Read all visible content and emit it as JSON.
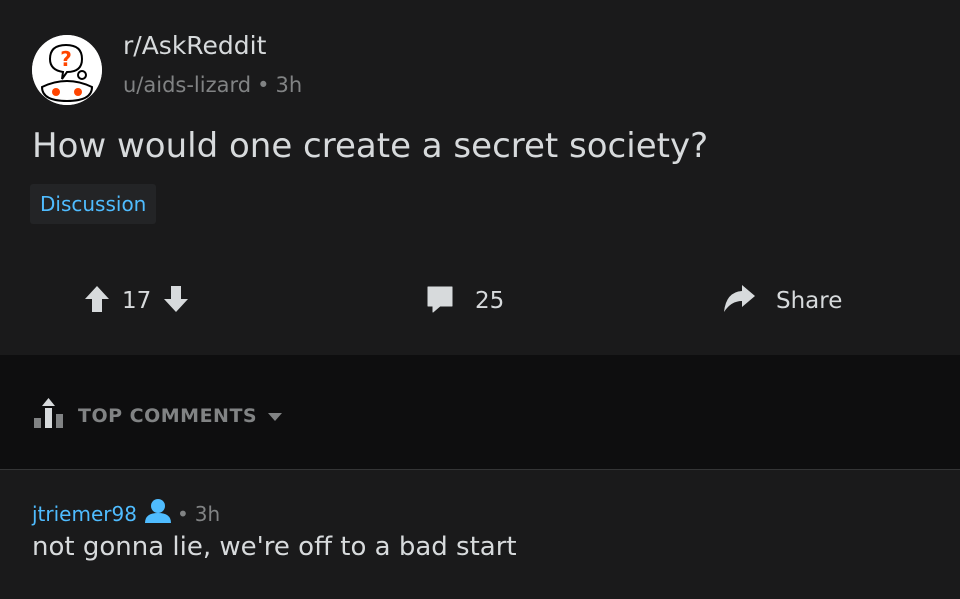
{
  "post": {
    "subreddit": "r/AskReddit",
    "author": "u/aids-lizard",
    "time": "3h",
    "title": "How would one create a secret society?",
    "flair": "Discussion",
    "votes": "17",
    "comments": "25",
    "share_label": "Share"
  },
  "sort": {
    "label": "TOP COMMENTS"
  },
  "comment": {
    "author": "jtriemer98",
    "time": "3h",
    "body": "not gonna lie, we're off to a bad start"
  },
  "colors": {
    "accent": "#4fbcff",
    "text": "#d7dadc",
    "muted": "#818384",
    "background": "#1a1a1b"
  }
}
